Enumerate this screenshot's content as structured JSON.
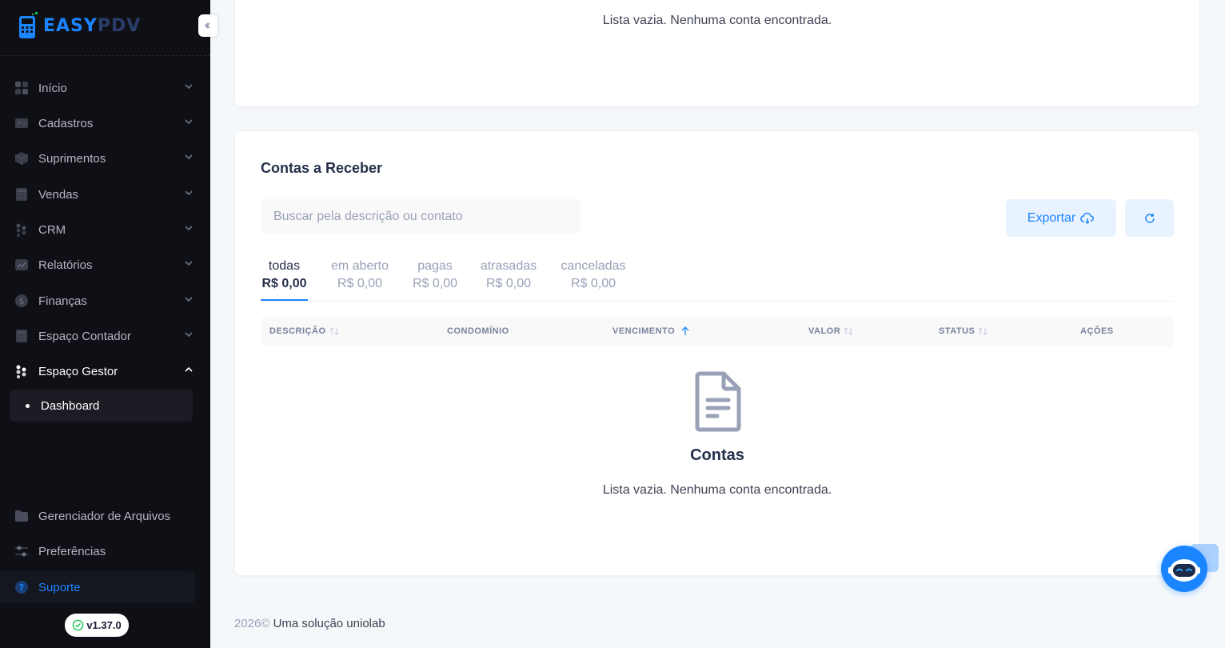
{
  "brand": {
    "part1": "EASY",
    "part2": "PDV"
  },
  "sidebar": {
    "items": [
      {
        "label": "Início",
        "icon": "home-icon"
      },
      {
        "label": "Cadastros",
        "icon": "id-card-icon"
      },
      {
        "label": "Suprimentos",
        "icon": "box-icon"
      },
      {
        "label": "Vendas",
        "icon": "calculator-icon"
      },
      {
        "label": "CRM",
        "icon": "people-icon"
      },
      {
        "label": "Relatórios",
        "icon": "chart-icon"
      },
      {
        "label": "Finanças",
        "icon": "dollar-icon"
      },
      {
        "label": "Espaço Contador",
        "icon": "calculator-icon"
      },
      {
        "label": "Espaço Gestor",
        "icon": "people-icon"
      }
    ],
    "subitem": "Dashboard",
    "bottom_items": [
      {
        "label": "Gerenciador de Arquivos",
        "icon": "folder-icon"
      },
      {
        "label": "Preferências",
        "icon": "sliders-icon"
      }
    ],
    "support": "Suporte",
    "version": "v1.37.0"
  },
  "top_card": {
    "empty_msg": "Lista vazia. Nenhuma conta encontrada."
  },
  "receber": {
    "title": "Contas a Receber",
    "search_placeholder": "Buscar pela descrição ou contato",
    "export_label": "Exportar",
    "tabs": [
      {
        "label": "todas",
        "value": "R$ 0,00"
      },
      {
        "label": "em aberto",
        "value": "R$ 0,00"
      },
      {
        "label": "pagas",
        "value": "R$ 0,00"
      },
      {
        "label": "atrasadas",
        "value": "R$ 0,00"
      },
      {
        "label": "canceladas",
        "value": "R$ 0,00"
      }
    ],
    "columns": [
      "DESCRIÇÃO",
      "CONDOMÍNIO",
      "VENCIMENTO",
      "VALOR",
      "STATUS",
      "AÇÕES"
    ],
    "empty_title": "Contas",
    "empty_msg": "Lista vazia. Nenhuma conta encontrada."
  },
  "footer": {
    "year": "2026©",
    "text": "Uma solução uniolab"
  },
  "colors": {
    "primary": "#1b84ff",
    "sidebar_bg": "#0f1015",
    "success": "#17c653"
  }
}
